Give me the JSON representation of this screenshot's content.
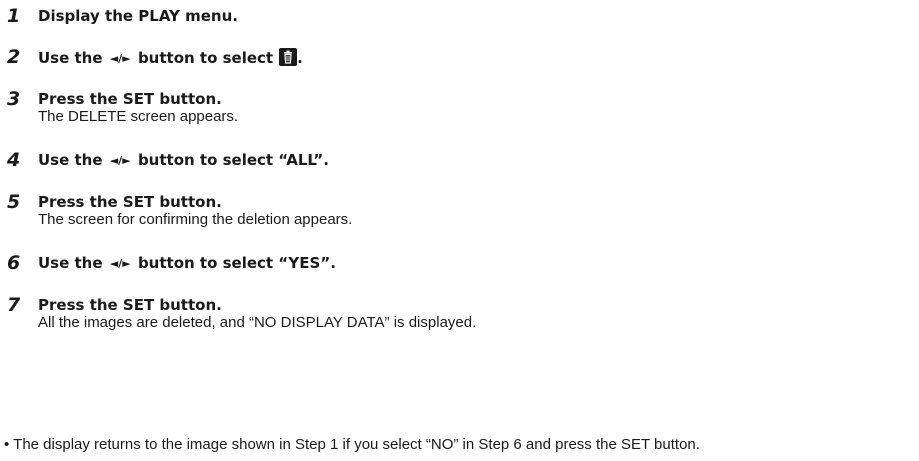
{
  "steps": [
    {
      "number": "1",
      "title": "Display the PLAY menu."
    },
    {
      "number": "2",
      "title_before": "Use the",
      "arrows": "◄/►",
      "title_mid": "button to select",
      "icon": "trash-icon",
      "title_after": "."
    },
    {
      "number": "3",
      "title": "Press the SET button.",
      "description": "The DELETE screen appears."
    },
    {
      "number": "4",
      "title_before": "Use the",
      "arrows": "◄/►",
      "title_after": "button to select “ALL”."
    },
    {
      "number": "5",
      "title": "Press the SET button.",
      "description": "The screen for confirming the deletion appears."
    },
    {
      "number": "6",
      "title_before": "Use the",
      "arrows": "◄/►",
      "title_after": "button to select “YES”."
    },
    {
      "number": "7",
      "title": "Press the SET button.",
      "description": "All the images are deleted, and “NO DISPLAY DATA” is displayed."
    }
  ],
  "note": {
    "bullet": "•",
    "text": "The display returns to the image shown in Step 1 if you select “NO” in Step 6 and press the SET button."
  }
}
